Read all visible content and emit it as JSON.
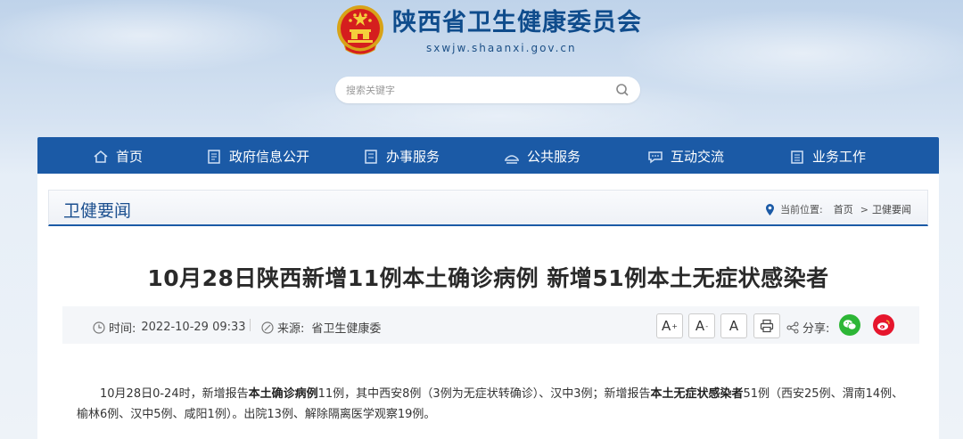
{
  "header": {
    "site_name": "陕西省卫生健康委员会",
    "site_url": "sxwjw.shaanxi.gov.cn",
    "search_placeholder": "搜索关键字"
  },
  "nav": {
    "items": [
      {
        "label": "首页",
        "icon": "home-icon"
      },
      {
        "label": "政府信息公开",
        "icon": "document-icon"
      },
      {
        "label": "办事服务",
        "icon": "list-icon"
      },
      {
        "label": "公共服务",
        "icon": "service-icon"
      },
      {
        "label": "互动交流",
        "icon": "chat-icon"
      },
      {
        "label": "业务工作",
        "icon": "briefcase-icon"
      }
    ]
  },
  "section": {
    "title": "卫健要闻",
    "location_label": "当前位置:",
    "crumb_home": "首页",
    "crumb_sep": ">",
    "crumb_current": "卫健要闻"
  },
  "article": {
    "title": "10月28日陕西新增11例本土确诊病例 新增51例本土无症状感染者",
    "time_label": "时间:",
    "time_value": "2022-10-29 09:33",
    "source_label": "来源:",
    "source_value": "省卫生健康委",
    "font_large": "A",
    "font_large_sup": "+",
    "font_small": "A",
    "font_small_sup": "-",
    "font_default": "A",
    "share_label": "分享:",
    "body": {
      "p1_a": "10月28日0-24时，新增报告",
      "p1_b": "本土确诊病例",
      "p1_c": "11例，其中西安8例（3例为无症状转确诊）、汉中3例；新增报告",
      "p1_d": "本土无症状感染者",
      "p1_e": "51例（西安25例、渭南14例、榆林6例、汉中5例、咸阳1例）。出院13例、解除隔离医学观察19例。"
    }
  },
  "colors": {
    "nav_bg": "#1b5aa6",
    "title_blue": "#0f4c8c",
    "wechat": "#2db636",
    "weibo": "#e6162d"
  }
}
